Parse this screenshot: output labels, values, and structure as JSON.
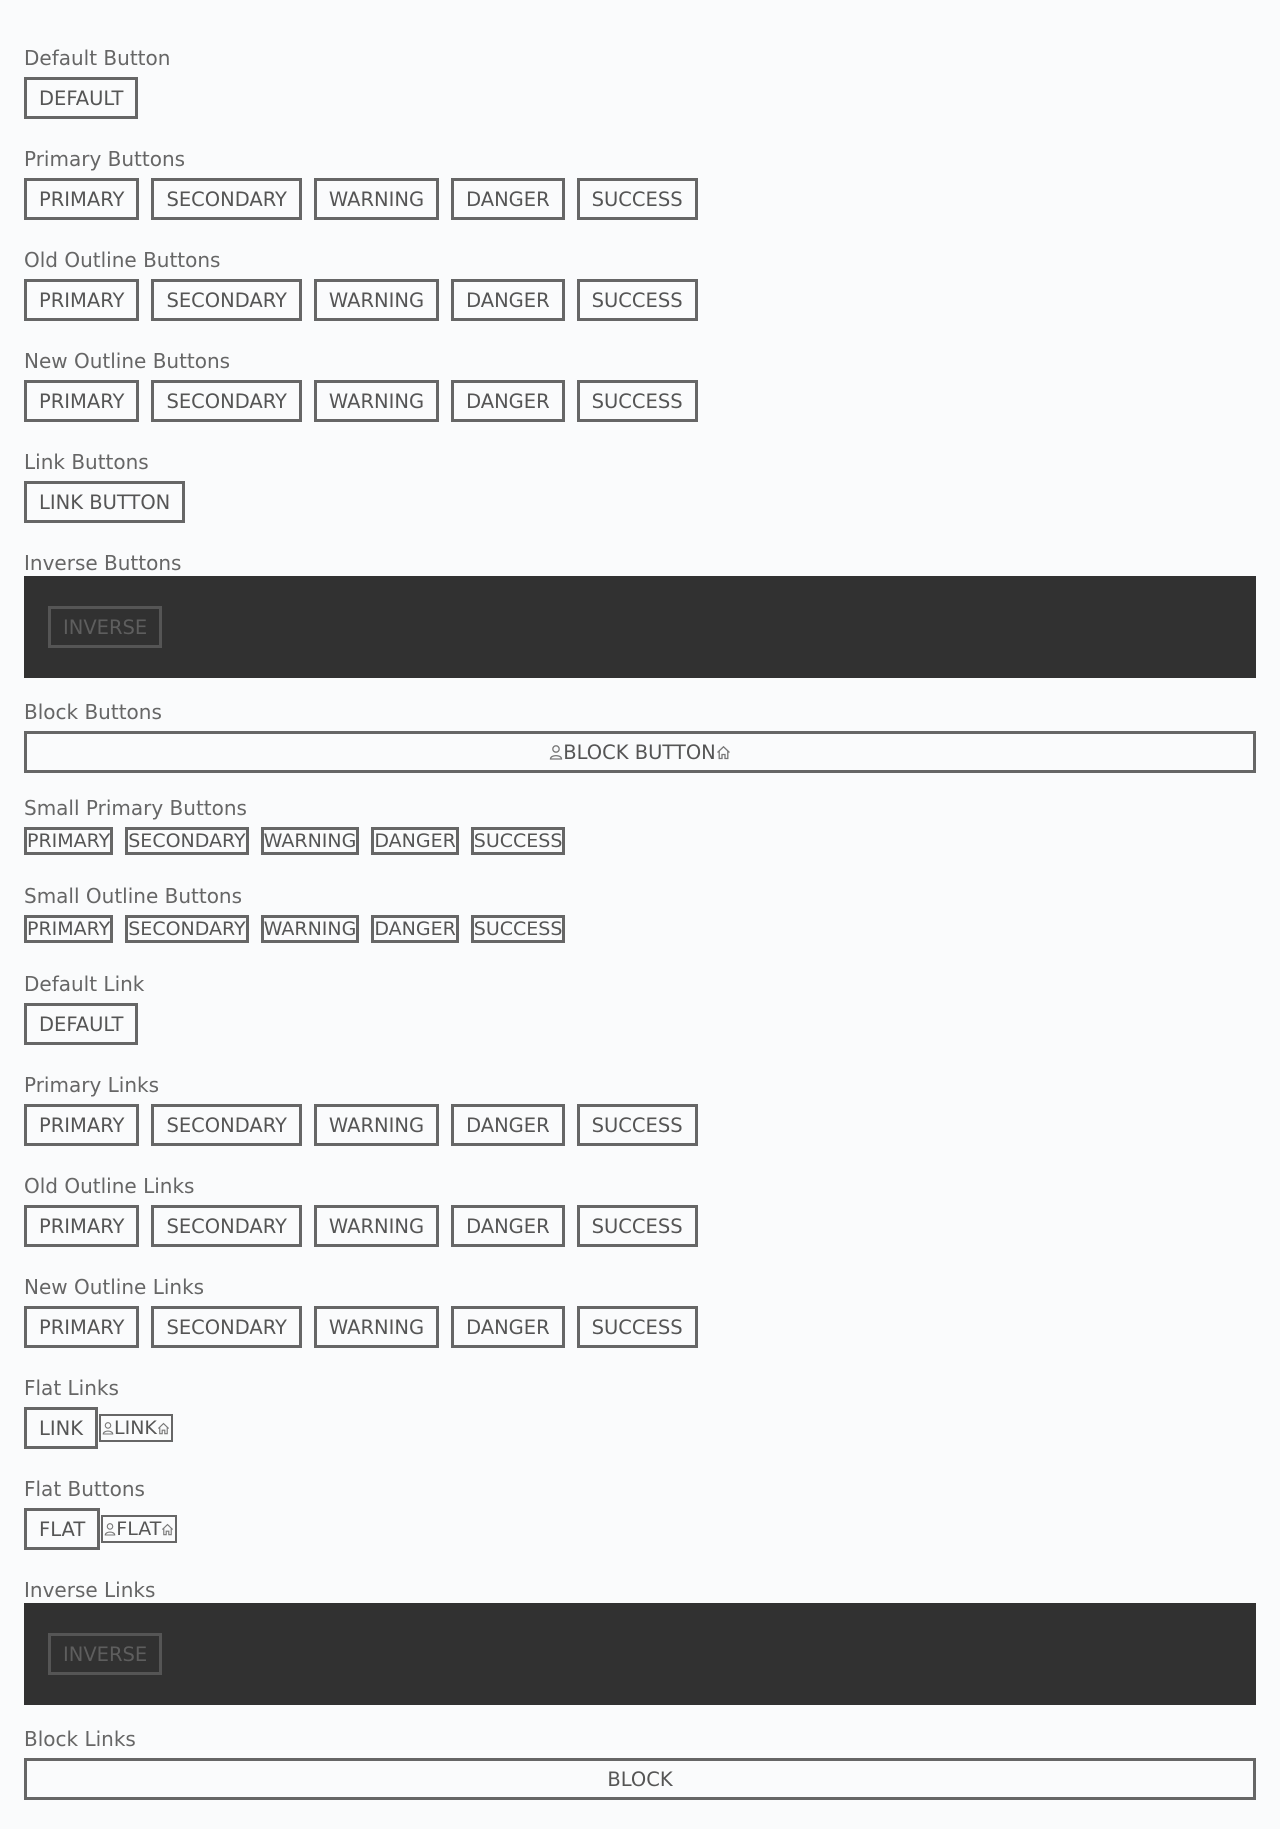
{
  "sections": {
    "default_button": {
      "title": "Default Button",
      "buttons": [
        "DEFAULT"
      ]
    },
    "primary_buttons": {
      "title": "Primary Buttons",
      "buttons": [
        "PRIMARY",
        "SECONDARY",
        "WARNING",
        "DANGER",
        "SUCCESS"
      ]
    },
    "old_outline_buttons": {
      "title": "Old Outline Buttons",
      "buttons": [
        "PRIMARY",
        "SECONDARY",
        "WARNING",
        "DANGER",
        "SUCCESS"
      ]
    },
    "new_outline_buttons": {
      "title": "New Outline Buttons",
      "buttons": [
        "PRIMARY",
        "SECONDARY",
        "WARNING",
        "DANGER",
        "SUCCESS"
      ]
    },
    "link_buttons": {
      "title": "Link Buttons",
      "buttons": [
        "LINK BUTTON"
      ]
    },
    "inverse_buttons": {
      "title": "Inverse Buttons",
      "buttons": [
        "INVERSE"
      ]
    },
    "block_buttons": {
      "title": "Block Buttons",
      "buttons": [
        "BLOCK BUTTON"
      ]
    },
    "small_primary_buttons": {
      "title": "Small Primary Buttons",
      "buttons": [
        "PRIMARY",
        "SECONDARY",
        "WARNING",
        "DANGER",
        "SUCCESS"
      ]
    },
    "small_outline_buttons": {
      "title": "Small Outline Buttons",
      "buttons": [
        "PRIMARY",
        "SECONDARY",
        "WARNING",
        "DANGER",
        "SUCCESS"
      ]
    },
    "default_link": {
      "title": "Default Link",
      "buttons": [
        "DEFAULT"
      ]
    },
    "primary_links": {
      "title": "Primary Links",
      "buttons": [
        "PRIMARY",
        "SECONDARY",
        "WARNING",
        "DANGER",
        "SUCCESS"
      ]
    },
    "old_outline_links": {
      "title": "Old Outline Links",
      "buttons": [
        "PRIMARY",
        "SECONDARY",
        "WARNING",
        "DANGER",
        "SUCCESS"
      ]
    },
    "new_outline_links": {
      "title": "New Outline Links",
      "buttons": [
        "PRIMARY",
        "SECONDARY",
        "WARNING",
        "DANGER",
        "SUCCESS"
      ]
    },
    "flat_links": {
      "title": "Flat Links",
      "buttons": [
        "LINK"
      ],
      "icon_button": "LINK"
    },
    "flat_buttons": {
      "title": "Flat Buttons",
      "buttons": [
        "FLAT"
      ],
      "icon_button": "FLAT"
    },
    "inverse_links": {
      "title": "Inverse Links",
      "buttons": [
        "INVERSE"
      ]
    },
    "block_links": {
      "title": "Block Links",
      "buttons": [
        "BLOCK"
      ]
    }
  },
  "icons": {
    "leading": "user-icon",
    "trailing": "home-icon"
  },
  "colors": {
    "border": "#666666",
    "text": "#555555",
    "dark_panel": "#313131",
    "background": "#fafbfc"
  }
}
